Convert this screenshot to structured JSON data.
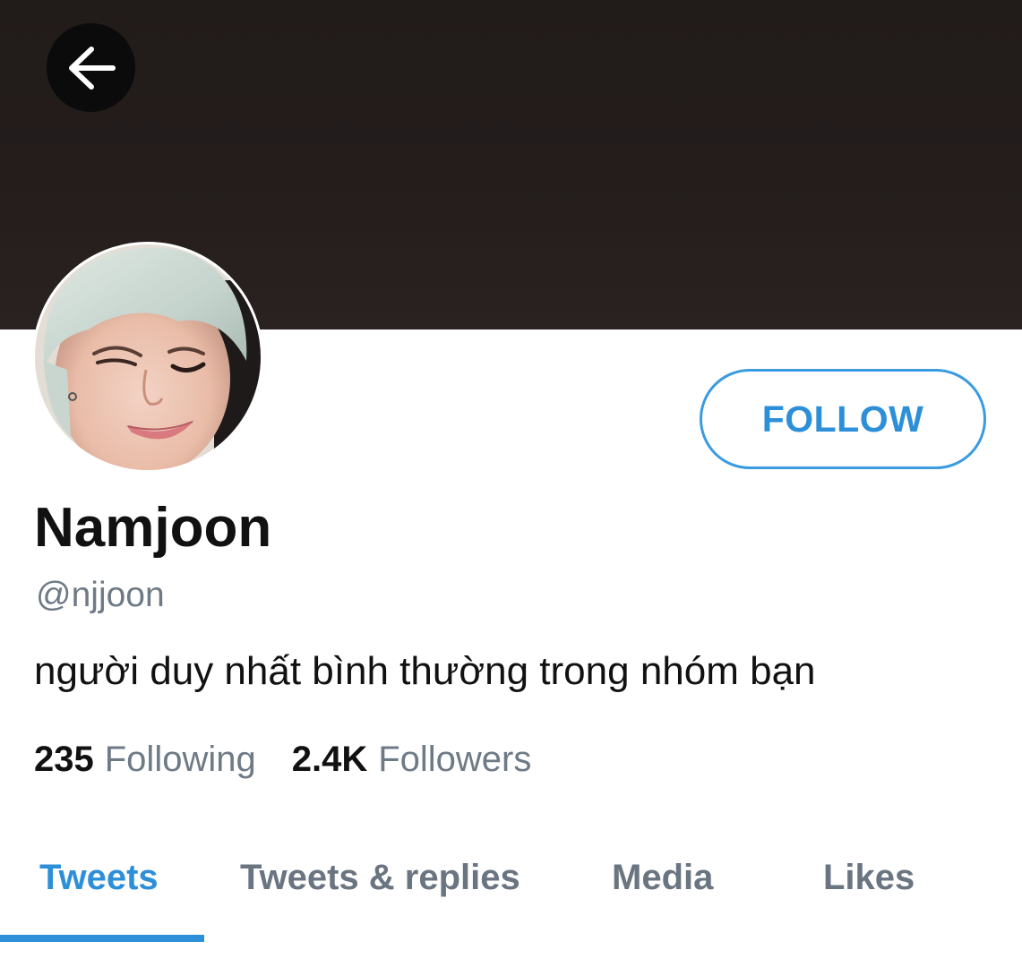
{
  "profile": {
    "display_name": "Namjoon",
    "handle": "@njjoon",
    "bio": "người duy nhất bình thường trong nhóm bạn"
  },
  "actions": {
    "back_icon": "arrow-left-icon",
    "follow_label": "FOLLOW"
  },
  "stats": {
    "following_count": "235",
    "following_label": "Following",
    "followers_count": "2.4K",
    "followers_label": "Followers"
  },
  "tabs": [
    {
      "label": "Tweets",
      "active": true
    },
    {
      "label": "Tweets & replies",
      "active": false
    },
    {
      "label": "Media",
      "active": false
    },
    {
      "label": "Likes",
      "active": false
    }
  ],
  "colors": {
    "accent": "#2d8fd8",
    "banner": "#231c1b",
    "secondary_text": "#6e7a86"
  }
}
